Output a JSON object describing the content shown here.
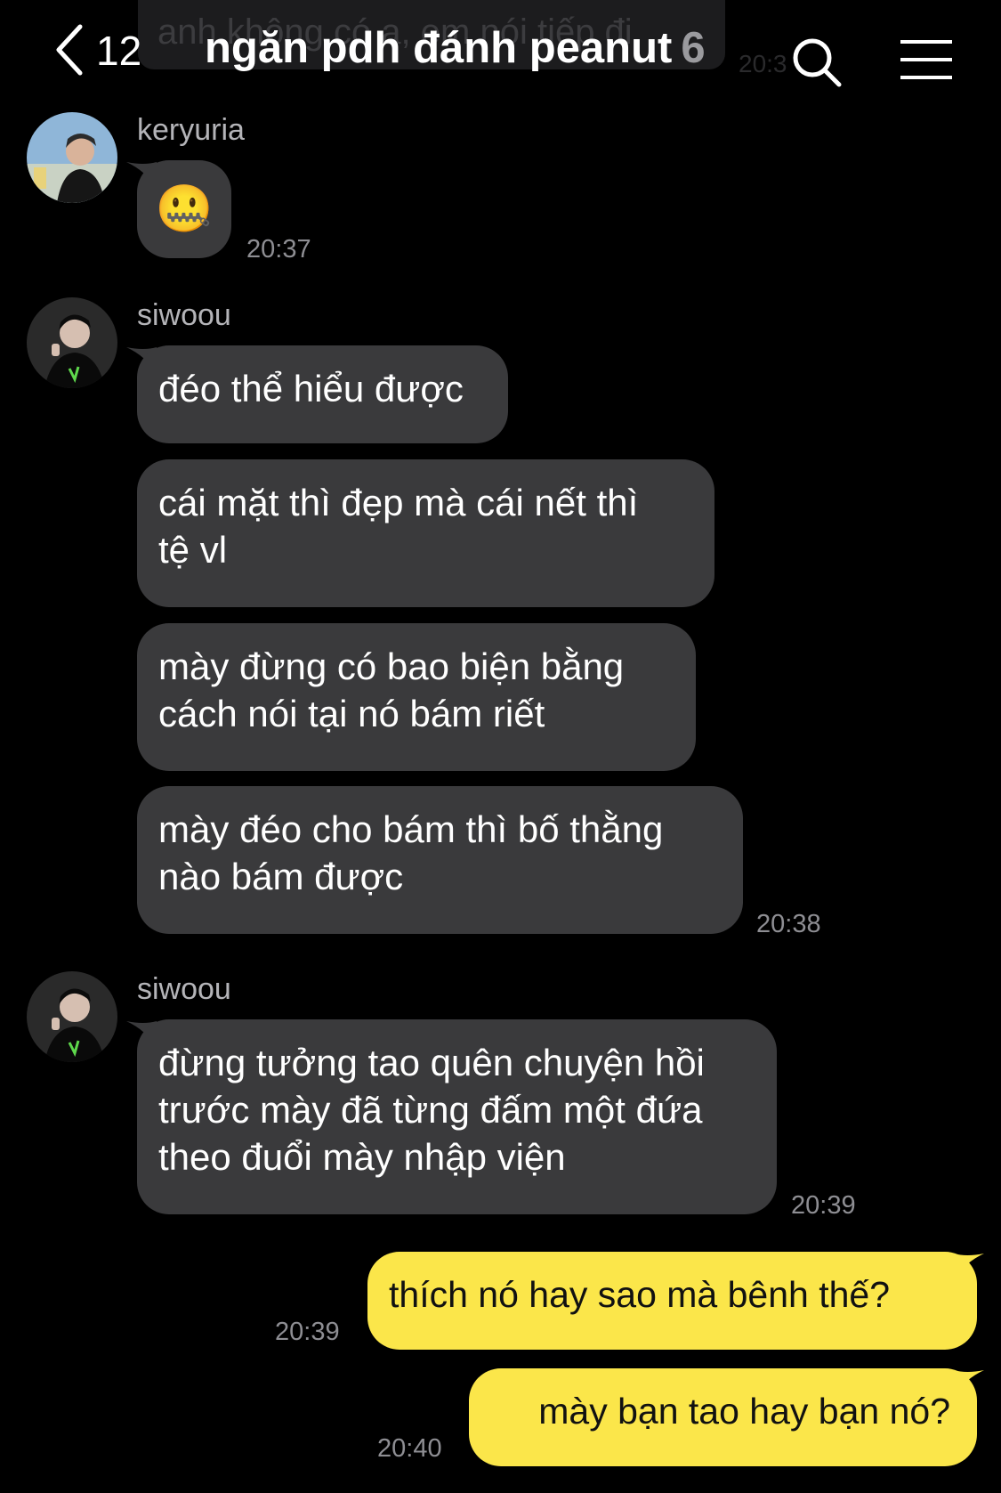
{
  "header": {
    "back_count": "12",
    "title": "ngăn pdh đánh peanut",
    "member_count": "6",
    "preview_text": "anh không có a, em nói tiếp đi",
    "preview_time": "20:3"
  },
  "messages": {
    "g1": {
      "sender": "keryuria",
      "emoji": "🤐",
      "time": "20:37"
    },
    "g2": {
      "sender": "siwoou",
      "b1": "đéo thể hiểu được",
      "b2": "cái mặt thì đẹp mà cái nết thì\ntệ vl",
      "b3": "mày đừng có bao biện bằng\ncách nói tại nó bám riết",
      "b4": "mày đéo cho bám thì bố thằng\nnào bám được",
      "time": "20:38"
    },
    "g3": {
      "sender": "siwoou",
      "b1": "đừng tưởng tao quên chuyện hồi\ntrước mày đã từng đấm một đứa\ntheo đuổi mày nhập viện",
      "time": "20:39"
    },
    "me1": {
      "text": "thích nó hay sao mà bênh thế?",
      "time": "20:39"
    },
    "me2": {
      "text": "mày bạn tao hay bạn nó?",
      "time": "20:40"
    }
  },
  "colors": {
    "background": "#000000",
    "incoming_bubble": "#3a3a3c",
    "outgoing_bubble": "#fbe64a",
    "timestamp": "#8e8e93"
  },
  "icons": [
    "chevron-left-icon",
    "search-icon",
    "hamburger-menu-icon",
    "avatar-keryuria",
    "avatar-siwoou"
  ]
}
